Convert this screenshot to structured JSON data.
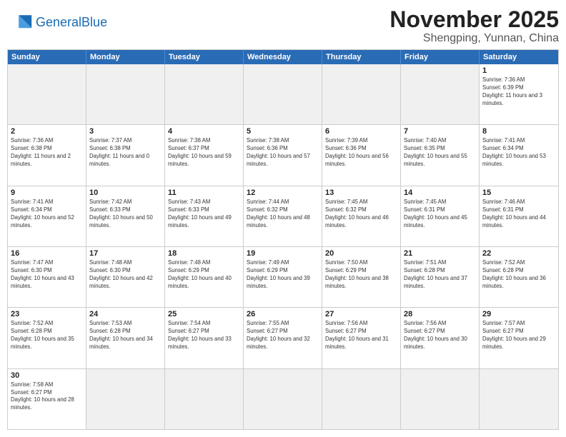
{
  "header": {
    "logo_general": "General",
    "logo_blue": "Blue",
    "month": "November 2025",
    "location": "Shengping, Yunnan, China"
  },
  "day_headers": [
    "Sunday",
    "Monday",
    "Tuesday",
    "Wednesday",
    "Thursday",
    "Friday",
    "Saturday"
  ],
  "weeks": [
    [
      {
        "day": "",
        "info": "",
        "empty": true
      },
      {
        "day": "",
        "info": "",
        "empty": true
      },
      {
        "day": "",
        "info": "",
        "empty": true
      },
      {
        "day": "",
        "info": "",
        "empty": true
      },
      {
        "day": "",
        "info": "",
        "empty": true
      },
      {
        "day": "",
        "info": "",
        "empty": true
      },
      {
        "day": "1",
        "info": "Sunrise: 7:36 AM\nSunset: 6:39 PM\nDaylight: 11 hours and 3 minutes."
      }
    ],
    [
      {
        "day": "2",
        "info": "Sunrise: 7:36 AM\nSunset: 6:38 PM\nDaylight: 11 hours and 2 minutes."
      },
      {
        "day": "3",
        "info": "Sunrise: 7:37 AM\nSunset: 6:38 PM\nDaylight: 11 hours and 0 minutes."
      },
      {
        "day": "4",
        "info": "Sunrise: 7:38 AM\nSunset: 6:37 PM\nDaylight: 10 hours and 59 minutes."
      },
      {
        "day": "5",
        "info": "Sunrise: 7:38 AM\nSunset: 6:36 PM\nDaylight: 10 hours and 57 minutes."
      },
      {
        "day": "6",
        "info": "Sunrise: 7:39 AM\nSunset: 6:36 PM\nDaylight: 10 hours and 56 minutes."
      },
      {
        "day": "7",
        "info": "Sunrise: 7:40 AM\nSunset: 6:35 PM\nDaylight: 10 hours and 55 minutes."
      },
      {
        "day": "8",
        "info": "Sunrise: 7:41 AM\nSunset: 6:34 PM\nDaylight: 10 hours and 53 minutes."
      }
    ],
    [
      {
        "day": "9",
        "info": "Sunrise: 7:41 AM\nSunset: 6:34 PM\nDaylight: 10 hours and 52 minutes."
      },
      {
        "day": "10",
        "info": "Sunrise: 7:42 AM\nSunset: 6:33 PM\nDaylight: 10 hours and 50 minutes."
      },
      {
        "day": "11",
        "info": "Sunrise: 7:43 AM\nSunset: 6:33 PM\nDaylight: 10 hours and 49 minutes."
      },
      {
        "day": "12",
        "info": "Sunrise: 7:44 AM\nSunset: 6:32 PM\nDaylight: 10 hours and 48 minutes."
      },
      {
        "day": "13",
        "info": "Sunrise: 7:45 AM\nSunset: 6:32 PM\nDaylight: 10 hours and 46 minutes."
      },
      {
        "day": "14",
        "info": "Sunrise: 7:45 AM\nSunset: 6:31 PM\nDaylight: 10 hours and 45 minutes."
      },
      {
        "day": "15",
        "info": "Sunrise: 7:46 AM\nSunset: 6:31 PM\nDaylight: 10 hours and 44 minutes."
      }
    ],
    [
      {
        "day": "16",
        "info": "Sunrise: 7:47 AM\nSunset: 6:30 PM\nDaylight: 10 hours and 43 minutes."
      },
      {
        "day": "17",
        "info": "Sunrise: 7:48 AM\nSunset: 6:30 PM\nDaylight: 10 hours and 42 minutes."
      },
      {
        "day": "18",
        "info": "Sunrise: 7:48 AM\nSunset: 6:29 PM\nDaylight: 10 hours and 40 minutes."
      },
      {
        "day": "19",
        "info": "Sunrise: 7:49 AM\nSunset: 6:29 PM\nDaylight: 10 hours and 39 minutes."
      },
      {
        "day": "20",
        "info": "Sunrise: 7:50 AM\nSunset: 6:29 PM\nDaylight: 10 hours and 38 minutes."
      },
      {
        "day": "21",
        "info": "Sunrise: 7:51 AM\nSunset: 6:28 PM\nDaylight: 10 hours and 37 minutes."
      },
      {
        "day": "22",
        "info": "Sunrise: 7:52 AM\nSunset: 6:28 PM\nDaylight: 10 hours and 36 minutes."
      }
    ],
    [
      {
        "day": "23",
        "info": "Sunrise: 7:52 AM\nSunset: 6:28 PM\nDaylight: 10 hours and 35 minutes."
      },
      {
        "day": "24",
        "info": "Sunrise: 7:53 AM\nSunset: 6:28 PM\nDaylight: 10 hours and 34 minutes."
      },
      {
        "day": "25",
        "info": "Sunrise: 7:54 AM\nSunset: 6:27 PM\nDaylight: 10 hours and 33 minutes."
      },
      {
        "day": "26",
        "info": "Sunrise: 7:55 AM\nSunset: 6:27 PM\nDaylight: 10 hours and 32 minutes."
      },
      {
        "day": "27",
        "info": "Sunrise: 7:56 AM\nSunset: 6:27 PM\nDaylight: 10 hours and 31 minutes."
      },
      {
        "day": "28",
        "info": "Sunrise: 7:56 AM\nSunset: 6:27 PM\nDaylight: 10 hours and 30 minutes."
      },
      {
        "day": "29",
        "info": "Sunrise: 7:57 AM\nSunset: 6:27 PM\nDaylight: 10 hours and 29 minutes."
      }
    ],
    [
      {
        "day": "30",
        "info": "Sunrise: 7:58 AM\nSunset: 6:27 PM\nDaylight: 10 hours and 28 minutes."
      },
      {
        "day": "",
        "info": "",
        "empty": true
      },
      {
        "day": "",
        "info": "",
        "empty": true
      },
      {
        "day": "",
        "info": "",
        "empty": true
      },
      {
        "day": "",
        "info": "",
        "empty": true
      },
      {
        "day": "",
        "info": "",
        "empty": true
      },
      {
        "day": "",
        "info": "",
        "empty": true
      }
    ]
  ]
}
